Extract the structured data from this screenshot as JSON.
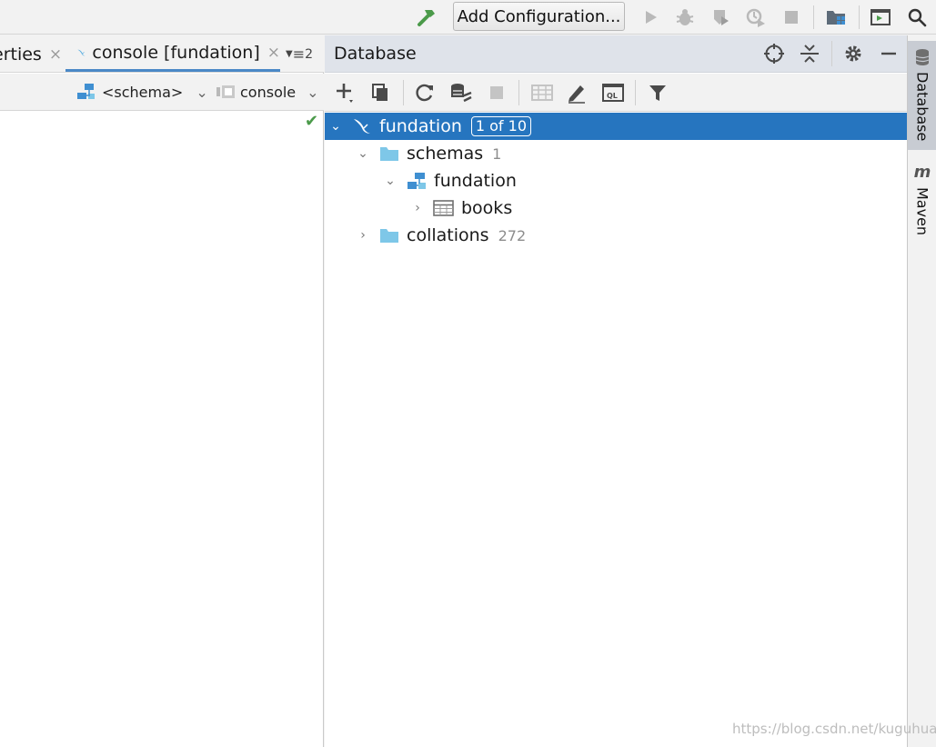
{
  "toolbar": {
    "add_configuration": "Add Configuration..."
  },
  "editor": {
    "tabs": [
      {
        "label": "erties",
        "close": "×"
      },
      {
        "label": "console [fundation]",
        "close": "×"
      }
    ],
    "tab_overflow_count": "2",
    "schema_selector": "<schema>",
    "session_selector": "console"
  },
  "database": {
    "title": "Database",
    "tree": [
      {
        "label": "fundation",
        "badge": "1 of 10"
      },
      {
        "label": "schemas",
        "count": "1"
      },
      {
        "label": "fundation"
      },
      {
        "label": "books"
      },
      {
        "label": "collations",
        "count": "272"
      }
    ]
  },
  "side_strip": {
    "database_tab": "Database",
    "maven_tab": "Maven",
    "maven_icon": "m"
  },
  "watermark": "https://blog.csdn.net/kuguhuan",
  "colors": {
    "selection": "#2675bf",
    "panel_header": "#dfe3ea",
    "folder": "#7ec7e8",
    "schema_icon": "#3f8fd1",
    "build_hammer": "#4b9a4a"
  },
  "icons": [
    "hammer-icon",
    "run-icon",
    "debug-icon",
    "coverage-icon",
    "profile-icon",
    "stop-icon",
    "project-structure-icon",
    "run-anything-icon",
    "search-icon",
    "locate-icon",
    "collapse-all-icon",
    "settings-icon",
    "minimize-icon",
    "add-icon",
    "duplicate-icon",
    "refresh-icon",
    "schema-sync-icon",
    "table-icon",
    "edit-icon",
    "sql-console-icon",
    "filter-icon",
    "mysql-dolphin-icon",
    "folder-icon",
    "schema-icon",
    "checkmark-icon"
  ]
}
